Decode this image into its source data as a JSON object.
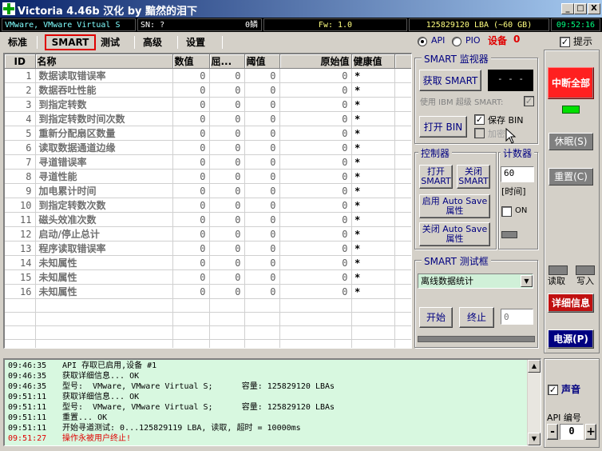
{
  "window": {
    "title": "Victoria 4.46b 汉化 by 黯然的泪下",
    "min": "_",
    "max": "□",
    "close": "X"
  },
  "status": {
    "device": "VMware, VMware Virtual S",
    "sn": "SN: ?",
    "temp": "0鳞",
    "fw": "Fw: 1.0",
    "lba": "125829120 LBA (~60 GB)",
    "time": "09:52:16"
  },
  "tabs": [
    "标准",
    "SMART",
    "测试",
    "高级",
    "设置"
  ],
  "mode": {
    "api": "API",
    "pio": "PIO",
    "device_label": "设备",
    "device_num": "0",
    "hint": "提示"
  },
  "table": {
    "headers": [
      "ID",
      "名称",
      "数值",
      "屈...",
      "阈值",
      "原始值",
      "健康值"
    ],
    "rows": [
      [
        "1",
        "数据读取错误率",
        "0",
        "0",
        "0",
        "0",
        "*"
      ],
      [
        "2",
        "数据吞吐性能",
        "0",
        "0",
        "0",
        "0",
        "*"
      ],
      [
        "3",
        "到指定转数",
        "0",
        "0",
        "0",
        "0",
        "*"
      ],
      [
        "4",
        "到指定转数时间次数",
        "0",
        "0",
        "0",
        "0",
        "*"
      ],
      [
        "5",
        "重新分配扇区数量",
        "0",
        "0",
        "0",
        "0",
        "*"
      ],
      [
        "6",
        "读取数据通道边缘",
        "0",
        "0",
        "0",
        "0",
        "*"
      ],
      [
        "7",
        "寻道错误率",
        "0",
        "0",
        "0",
        "0",
        "*"
      ],
      [
        "8",
        "寻道性能",
        "0",
        "0",
        "0",
        "0",
        "*"
      ],
      [
        "9",
        "加电累计时间",
        "0",
        "0",
        "0",
        "0",
        "*"
      ],
      [
        "10",
        "到指定转数次数",
        "0",
        "0",
        "0",
        "0",
        "*"
      ],
      [
        "11",
        "磁头效准次数",
        "0",
        "0",
        "0",
        "0",
        "*"
      ],
      [
        "12",
        "启动/停止总计",
        "0",
        "0",
        "0",
        "0",
        "*"
      ],
      [
        "13",
        "程序读取错误率",
        "0",
        "0",
        "0",
        "0",
        "*"
      ],
      [
        "14",
        "未知属性",
        "0",
        "0",
        "0",
        "0",
        "*"
      ],
      [
        "15",
        "未知属性",
        "0",
        "0",
        "0",
        "0",
        "*"
      ],
      [
        "16",
        "未知属性",
        "0",
        "0",
        "0",
        "0",
        "*"
      ]
    ]
  },
  "smart_monitor": {
    "title": "SMART 监视器",
    "get_smart": "获取 SMART",
    "display": "- - -",
    "use_ibm": "使用 IBM 超级 SMART:",
    "open_bin": "打开 BIN",
    "save_bin": "保存 BIN",
    "add": "加密"
  },
  "controller": {
    "title": "控制器",
    "open_smart": "打开 SMART",
    "close_smart": "关闭 SMART",
    "enable_autosave": "启用 Auto Save 属性",
    "disable_autosave": "关闭 Auto Save 属性"
  },
  "counter": {
    "title": "计数器",
    "value": "60",
    "unit": "[时间]",
    "on": "ON"
  },
  "smart_test": {
    "title": "SMART 测试框",
    "select": "离线数据统计",
    "start": "开始",
    "stop": "终止",
    "field_placeholder": "0"
  },
  "right_panel": {
    "abort_all": "中断全部",
    "sleep": "休眠(S)",
    "reset": "重置(C)",
    "read": "读取",
    "write": "写入",
    "details": "详细信息",
    "power": "电源(P)",
    "sound": "声音",
    "api_num_label": "API 编号",
    "api_num": "0",
    "minus": "-",
    "plus": "+"
  },
  "log": [
    {
      "time": "09:46:35",
      "text": "API 存取已启用,设备 #1",
      "red": false
    },
    {
      "time": "09:46:35",
      "text": "获取详细信息... OK",
      "red": false
    },
    {
      "time": "09:46:35",
      "text": "型号:  VMware, VMware Virtual S;      容量: 125829120 LBAs",
      "red": false
    },
    {
      "time": "09:51:11",
      "text": "获取详细信息... OK",
      "red": false
    },
    {
      "time": "09:51:11",
      "text": "型号:  VMware, VMware Virtual S;      容量: 125829120 LBAs",
      "red": false
    },
    {
      "time": "09:51:11",
      "text": "重置... OK",
      "red": false
    },
    {
      "time": "09:51:11",
      "text": "开始寻道测试: 0...125829119 LBA, 读取, 超时 = 10000ms",
      "red": false
    },
    {
      "time": "09:51:27",
      "text": "操作永被用户终止!",
      "red": true
    }
  ],
  "colors": {
    "title_bg": "#0a246a",
    "status_bg": "#000000",
    "abort_red": "#ff2020",
    "details_red": "#c01010",
    "power_blue": "#000080",
    "log_bg": "#d8f8e0"
  }
}
